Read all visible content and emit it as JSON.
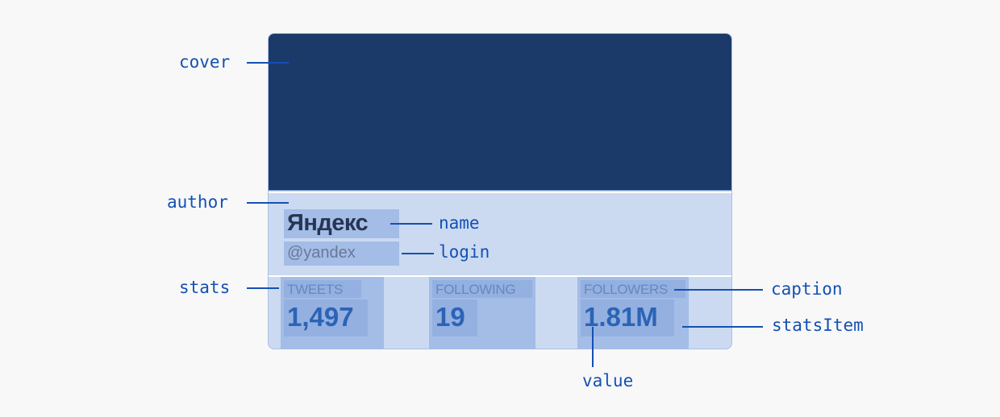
{
  "card": {
    "name": "Яндекс",
    "login": "@yandex",
    "stats": [
      {
        "caption": "TWEETS",
        "value": "1,497"
      },
      {
        "caption": "FOLLOWING",
        "value": "19"
      },
      {
        "caption": "FOLLOWERS",
        "value": "1.81M"
      }
    ]
  },
  "annotations": {
    "cover": "cover",
    "author": "author",
    "stats": "stats",
    "name": "name",
    "login": "login",
    "caption": "caption",
    "statsItem": "statsItem",
    "value": "value"
  },
  "colors": {
    "cover": "#1c3a69",
    "card_background": "#cbdaf1",
    "highlight": "#a3bde7",
    "annotation": "#1450b4"
  }
}
